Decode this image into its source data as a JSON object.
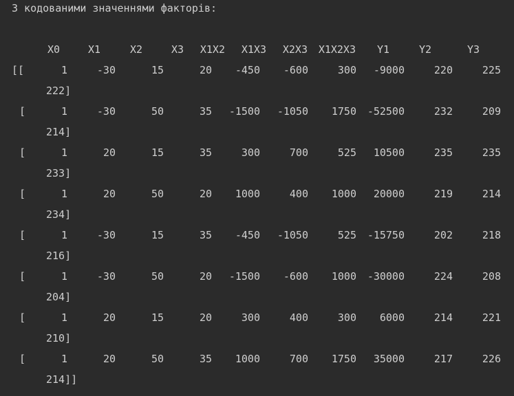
{
  "title": "З кодованими значеннями факторів:",
  "headers": [
    "X0",
    "X1",
    "X2",
    "X3",
    "X1X2",
    "X1X3",
    "X2X3",
    "X1X2X3",
    "Y1",
    "Y2",
    "Y3"
  ],
  "rows": [
    {
      "open": "[[",
      "values": [
        "1",
        "-30",
        "15",
        "20",
        "-450",
        "-600",
        "300",
        "-9000",
        "220",
        "225"
      ],
      "cont": "222]"
    },
    {
      "open": "[",
      "values": [
        "1",
        "-30",
        "50",
        "35",
        "-1500",
        "-1050",
        "1750",
        "-52500",
        "232",
        "209"
      ],
      "cont": "214]"
    },
    {
      "open": "[",
      "values": [
        "1",
        "20",
        "15",
        "35",
        "300",
        "700",
        "525",
        "10500",
        "235",
        "235"
      ],
      "cont": "233]"
    },
    {
      "open": "[",
      "values": [
        "1",
        "20",
        "50",
        "20",
        "1000",
        "400",
        "1000",
        "20000",
        "219",
        "214"
      ],
      "cont": "234]"
    },
    {
      "open": "[",
      "values": [
        "1",
        "-30",
        "15",
        "35",
        "-450",
        "-1050",
        "525",
        "-15750",
        "202",
        "218"
      ],
      "cont": "216]"
    },
    {
      "open": "[",
      "values": [
        "1",
        "-30",
        "50",
        "20",
        "-1500",
        "-600",
        "1000",
        "-30000",
        "224",
        "208"
      ],
      "cont": "204]"
    },
    {
      "open": "[",
      "values": [
        "1",
        "20",
        "15",
        "20",
        "300",
        "400",
        "300",
        "6000",
        "214",
        "221"
      ],
      "cont": "210]"
    },
    {
      "open": "[",
      "values": [
        "1",
        "20",
        "50",
        "35",
        "1000",
        "700",
        "1750",
        "35000",
        "217",
        "226"
      ],
      "cont": "214]]"
    }
  ]
}
